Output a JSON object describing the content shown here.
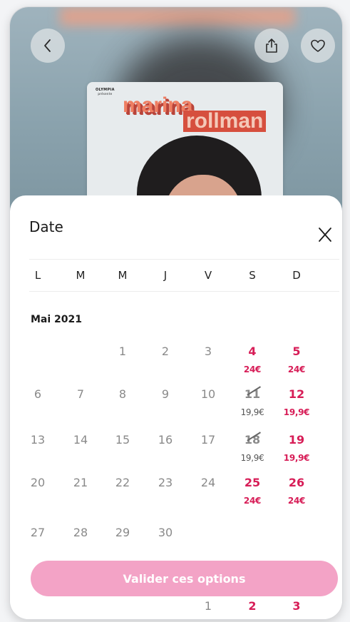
{
  "hero": {
    "poster_brand": "OLYMPIA",
    "poster_brand_sub": "présente",
    "poster_title_line1": "marina",
    "poster_title_line2": "rollman"
  },
  "top_actions": {
    "back_icon": "chevron-left-icon",
    "share_icon": "share-icon",
    "like_icon": "heart-icon"
  },
  "sheet": {
    "title": "Date",
    "close_icon": "close-icon",
    "weekdays": [
      "L",
      "M",
      "M",
      "J",
      "V",
      "S",
      "D"
    ],
    "month": "Mai 2021",
    "weeks": [
      [
        {
          "n": "",
          "p": ""
        },
        {
          "n": "",
          "p": ""
        },
        {
          "n": "1",
          "p": ""
        },
        {
          "n": "2",
          "p": ""
        },
        {
          "n": "3",
          "p": ""
        },
        {
          "n": "4",
          "p": "24€"
        },
        {
          "n": "5",
          "p": "24€"
        }
      ],
      [
        {
          "n": "6",
          "p": ""
        },
        {
          "n": "7",
          "p": ""
        },
        {
          "n": "8",
          "p": ""
        },
        {
          "n": "9",
          "p": ""
        },
        {
          "n": "10",
          "p": ""
        },
        {
          "n": "11",
          "p": "19,9€"
        },
        {
          "n": "12",
          "p": "19,9€"
        }
      ],
      [
        {
          "n": "13",
          "p": ""
        },
        {
          "n": "14",
          "p": ""
        },
        {
          "n": "15",
          "p": ""
        },
        {
          "n": "16",
          "p": ""
        },
        {
          "n": "17",
          "p": ""
        },
        {
          "n": "18",
          "p": "19,9€"
        },
        {
          "n": "19",
          "p": "19,9€"
        }
      ],
      [
        {
          "n": "20",
          "p": ""
        },
        {
          "n": "21",
          "p": ""
        },
        {
          "n": "22",
          "p": ""
        },
        {
          "n": "23",
          "p": ""
        },
        {
          "n": "24",
          "p": ""
        },
        {
          "n": "25",
          "p": "24€"
        },
        {
          "n": "26",
          "p": "24€"
        }
      ],
      [
        {
          "n": "27",
          "p": ""
        },
        {
          "n": "28",
          "p": ""
        },
        {
          "n": "29",
          "p": ""
        },
        {
          "n": "30",
          "p": ""
        },
        {
          "n": "",
          "p": ""
        },
        {
          "n": "",
          "p": ""
        },
        {
          "n": "",
          "p": ""
        }
      ],
      [
        {
          "n": "",
          "p": ""
        },
        {
          "n": "",
          "p": ""
        },
        {
          "n": "",
          "p": ""
        },
        {
          "n": "",
          "p": ""
        },
        {
          "n": "1",
          "p": ""
        },
        {
          "n": "2",
          "p": ""
        },
        {
          "n": "3",
          "p": ""
        }
      ]
    ],
    "unavailable_days": [
      "11",
      "18"
    ],
    "cta_label": "Valider ces options"
  },
  "colors": {
    "accent": "#d71d57",
    "cta_background": "#f3a3c6",
    "muted_day": "#8a8a8a"
  }
}
